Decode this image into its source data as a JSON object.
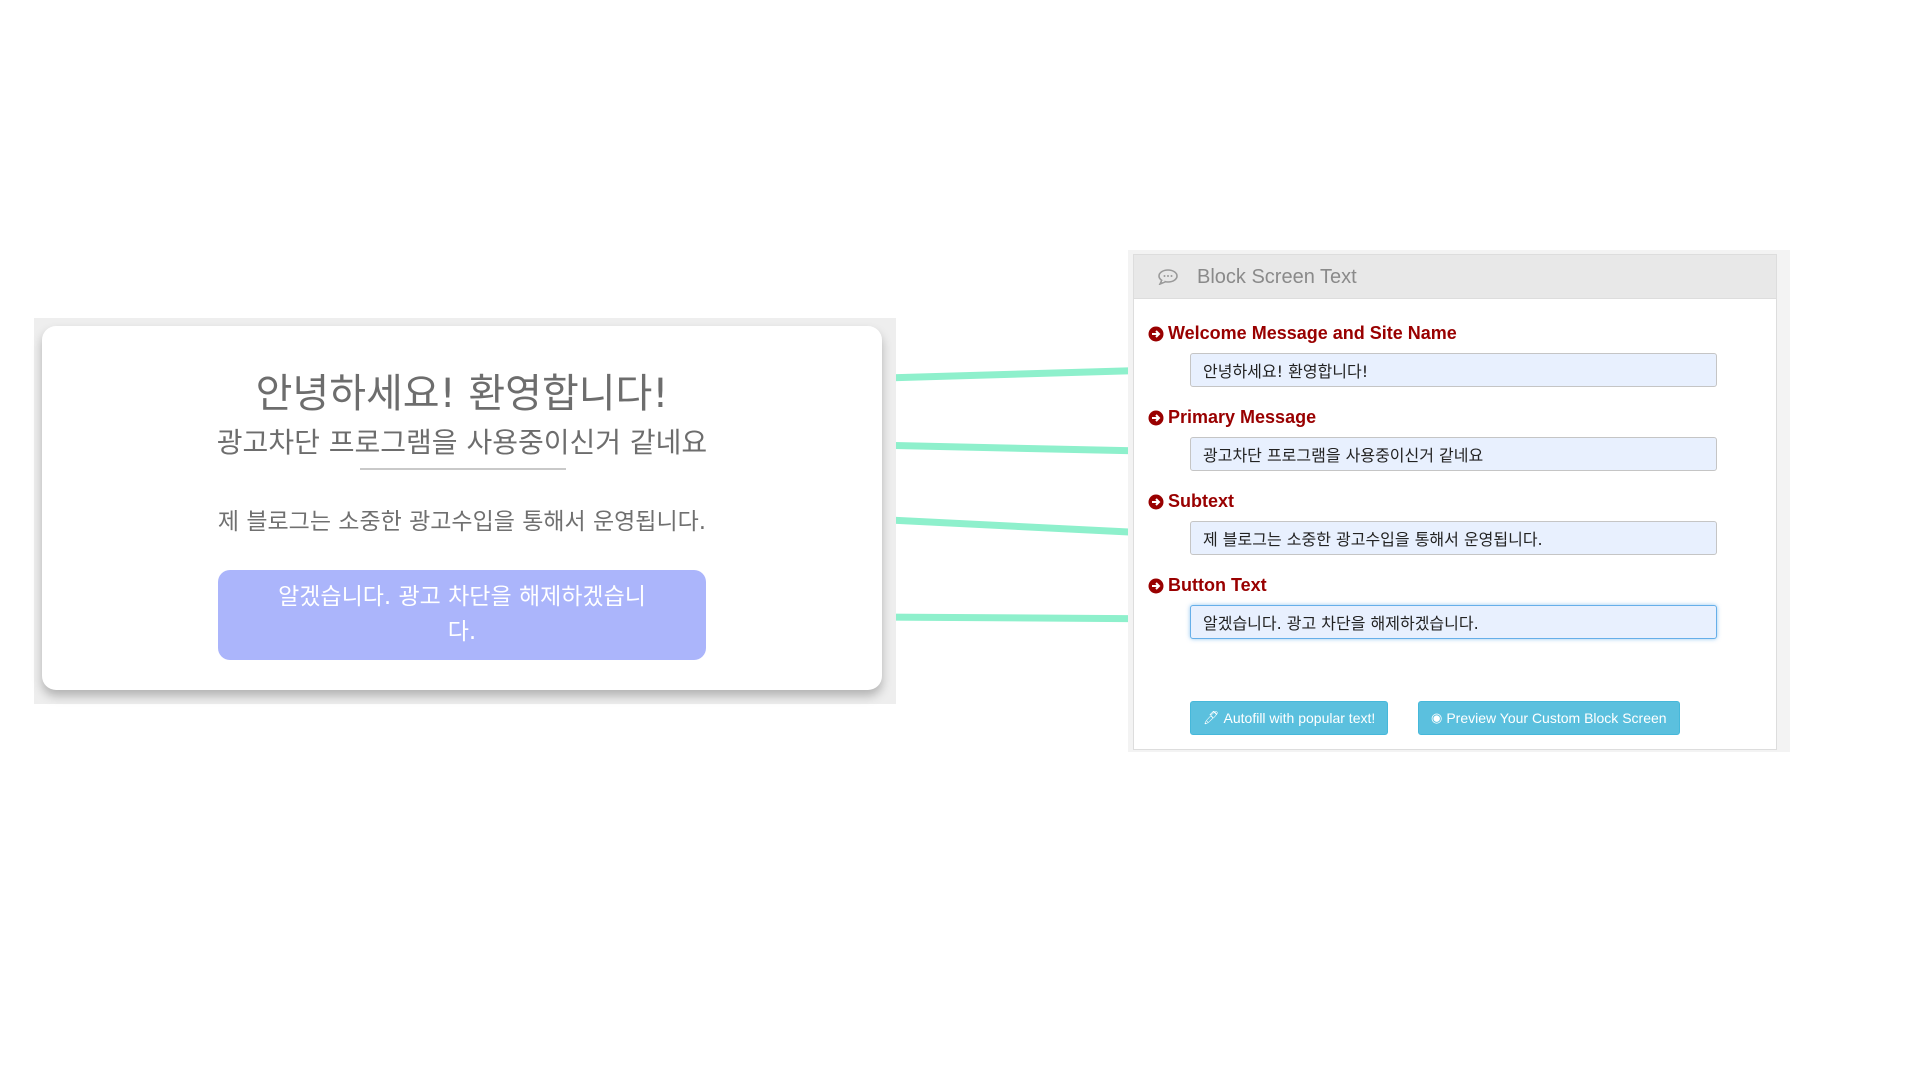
{
  "preview": {
    "welcome": "안녕하세요! 환영합니다!",
    "primary": "광고차단 프로그램을 사용중이신거 같네요",
    "subtext": "제 블로그는 소중한 광고수입을 통해서 운영됩니다.",
    "button": "알겠습니다. 광고 차단을 해제하겠습니다."
  },
  "panel": {
    "title": "Block Screen Text",
    "title_icon": "comment-icon",
    "fields": [
      {
        "label": "Welcome Message and Site Name",
        "value": "안녕하세요! 환영합니다!"
      },
      {
        "label": "Primary Message",
        "value": "광고차단 프로그램을 사용중이신거 같네요"
      },
      {
        "label": "Subtext",
        "value": "제 블로그는 소중한 광고수입을 통해서 운영됩니다."
      },
      {
        "label": "Button Text",
        "value": "알겠습니다. 광고 차단을 해제하겠습니다."
      }
    ],
    "label_icon": "arrow-circle-right-icon",
    "buttons": {
      "autofill": "Autofill with popular text!",
      "autofill_icon": "magic-wand-icon",
      "preview": "Preview Your Custom Block Screen",
      "preview_icon": "eye-icon"
    }
  },
  "colors": {
    "label": "#990000",
    "connector": "#8ef0cc",
    "preview_button": "#abb5fb",
    "info_button": "#5bc0de",
    "input_bg": "#e8f0fe"
  }
}
